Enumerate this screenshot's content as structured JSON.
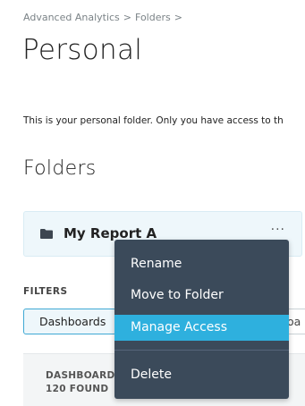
{
  "breadcrumb": {
    "items": [
      "Advanced Analytics",
      "Folders"
    ],
    "separator": ">"
  },
  "page": {
    "title": "Personal",
    "description": "This is your personal folder. Only you have access to th"
  },
  "folders_section": {
    "title": "Folders",
    "card": {
      "name": "My Report A",
      "icon": "folder-icon",
      "more_label": "···"
    }
  },
  "filters": {
    "label": "FILTERS",
    "tabs": [
      {
        "label": "Dashboards",
        "selected": true
      },
      {
        "label": "oa",
        "selected": false
      }
    ]
  },
  "results": {
    "title": "DASHBOARDS",
    "count": "120 FOUND"
  },
  "context_menu": {
    "items": [
      {
        "label": "Rename",
        "highlighted": false
      },
      {
        "label": "Move to Folder",
        "highlighted": false
      },
      {
        "label": "Manage Access",
        "highlighted": true
      },
      {
        "label": "Delete",
        "highlighted": false
      }
    ]
  },
  "colors": {
    "accent": "#2eb0de",
    "menu_bg": "#3b4a5a",
    "card_bg": "#eef7fb",
    "tab_border": "#3fa9d4"
  }
}
